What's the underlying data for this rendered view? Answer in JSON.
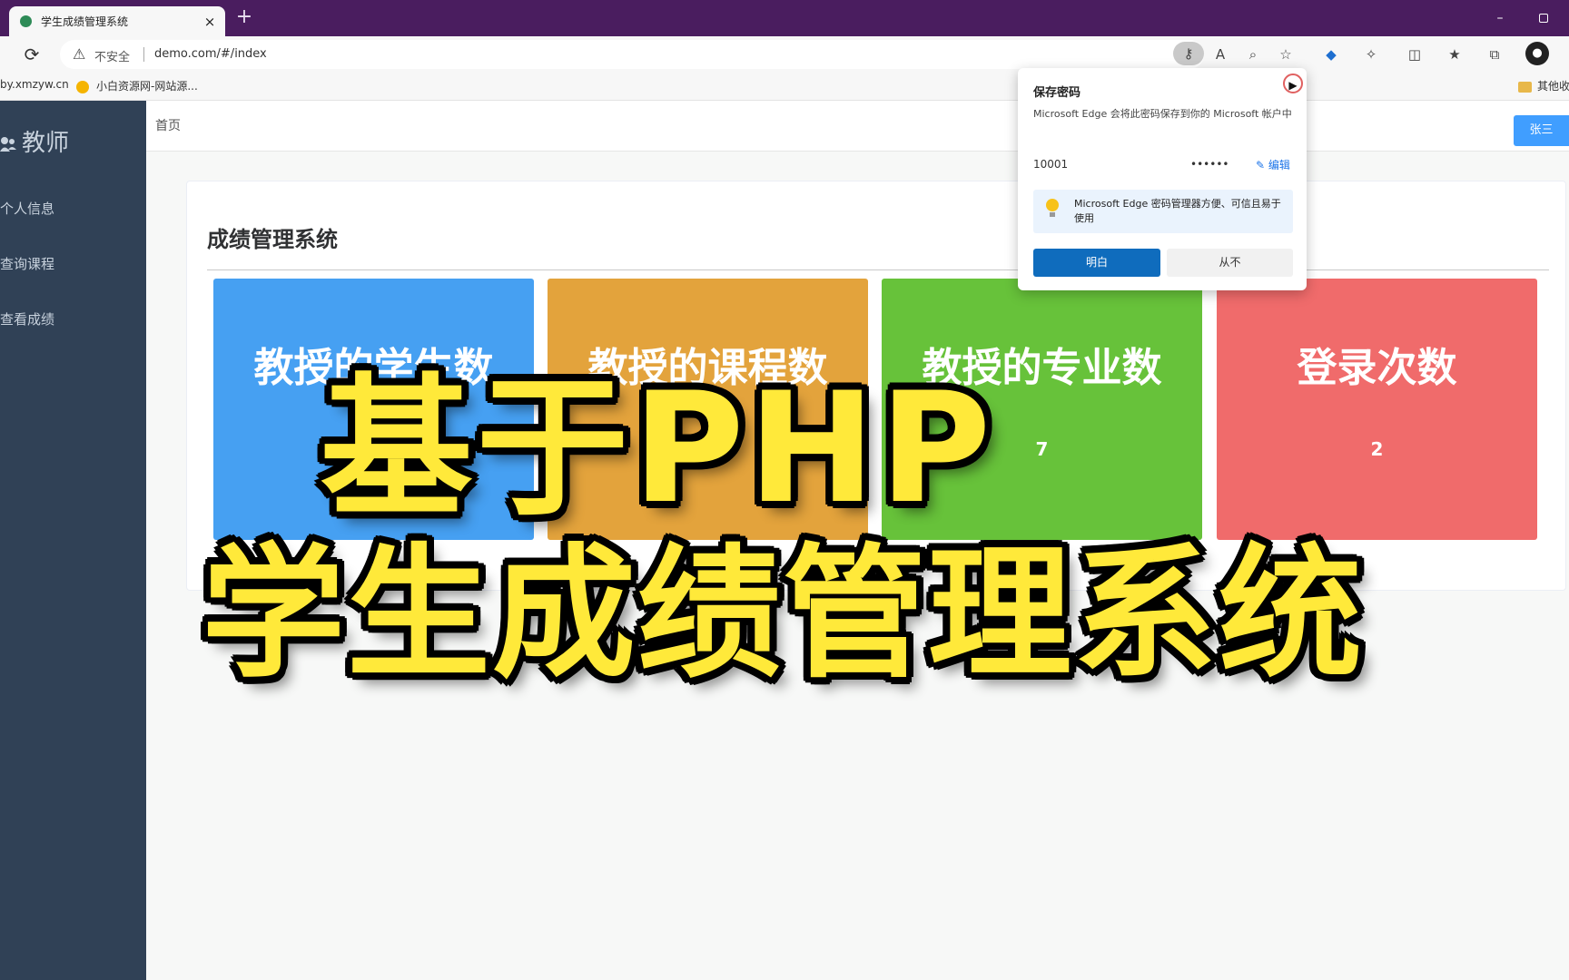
{
  "browser": {
    "tab_title": "学生成绩管理系统",
    "tab_close": "×",
    "new_tab": "+",
    "window_minimize": "–",
    "security_label": "不安全",
    "url": "demo.com/#/index"
  },
  "favorites": [
    {
      "label": "by.xmzyw.cn"
    },
    {
      "label": "小白资源网-网站源..."
    },
    {
      "label": "其他收"
    }
  ],
  "sidebar": {
    "title": "教师",
    "items": [
      {
        "label": "个人信息"
      },
      {
        "label": "查询课程"
      },
      {
        "label": "查看成绩"
      }
    ]
  },
  "header": {
    "breadcrumb": "首页",
    "user_button": "张三"
  },
  "main": {
    "title": "成绩管理系统",
    "stats": [
      {
        "label": "教授的学生数",
        "value": "",
        "color": "#46a0f2"
      },
      {
        "label": "教授的课程数",
        "value": "",
        "color": "#e3a33c"
      },
      {
        "label": "教授的专业数",
        "value": "7",
        "color": "#67c23a"
      },
      {
        "label": "登录次数",
        "value": "2",
        "color": "#f06b6b"
      }
    ]
  },
  "password_popup": {
    "title": "保存密码",
    "description": "Microsoft Edge 会将此密码保存到你的 Microsoft 帐户中",
    "username": "10001",
    "password_mask": "••••••",
    "edit_label": "编辑",
    "tip": "Microsoft Edge 密码管理器方便、可信且易于使用",
    "confirm_button": "明白",
    "never_button": "从不"
  },
  "overlay": {
    "line1": "基于PHP",
    "line2": "学生成绩管理系统"
  },
  "colors": {
    "titlebar": "#4a1d5f",
    "sidebar": "#304156",
    "accent": "#409eff",
    "overlay_text": "#ffe93a"
  }
}
